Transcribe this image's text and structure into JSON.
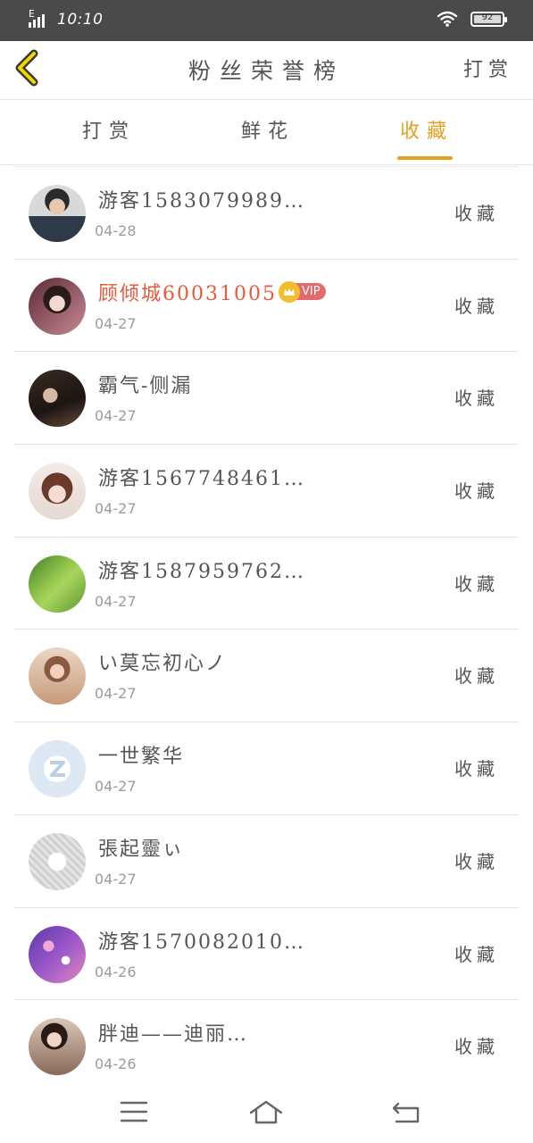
{
  "status_bar": {
    "network": "E",
    "time": "10:10",
    "battery": "92"
  },
  "header": {
    "title": "粉丝荣誉榜",
    "action_label": "打赏"
  },
  "tabs": [
    {
      "label": "打赏",
      "active": false
    },
    {
      "label": "鲜花",
      "active": false
    },
    {
      "label": "收藏",
      "active": true
    }
  ],
  "colors": {
    "accent": "#e3a11f",
    "vip_name": "#e65a3a",
    "vip_tag": "#e46b6b",
    "status_bar": "#4a4a4a"
  },
  "list": [
    {
      "name": "游客1583079989…",
      "date": "04-28",
      "action": "收藏"
    },
    {
      "name": "顾倾城60031005",
      "date": "04-27",
      "action": "收藏",
      "vip": "VIP"
    },
    {
      "name": "霸气-侧漏",
      "date": "04-27",
      "action": "收藏"
    },
    {
      "name": "游客1567748461…",
      "date": "04-27",
      "action": "收藏"
    },
    {
      "name": "游客1587959762…",
      "date": "04-27",
      "action": "收藏"
    },
    {
      "name": "い莫忘初心ノ",
      "date": "04-27",
      "action": "收藏"
    },
    {
      "name": "一世繁华",
      "date": "04-27",
      "action": "收藏"
    },
    {
      "name": "張起靈ぃ",
      "date": "04-27",
      "action": "收藏"
    },
    {
      "name": "游客1570082010…",
      "date": "04-26",
      "action": "收藏"
    },
    {
      "name": "胖迪——迪丽…",
      "date": "04-26",
      "action": "收藏"
    }
  ],
  "nav": {
    "menu_icon": "menu-icon",
    "home_icon": "home-icon",
    "back_icon": "return-icon"
  }
}
